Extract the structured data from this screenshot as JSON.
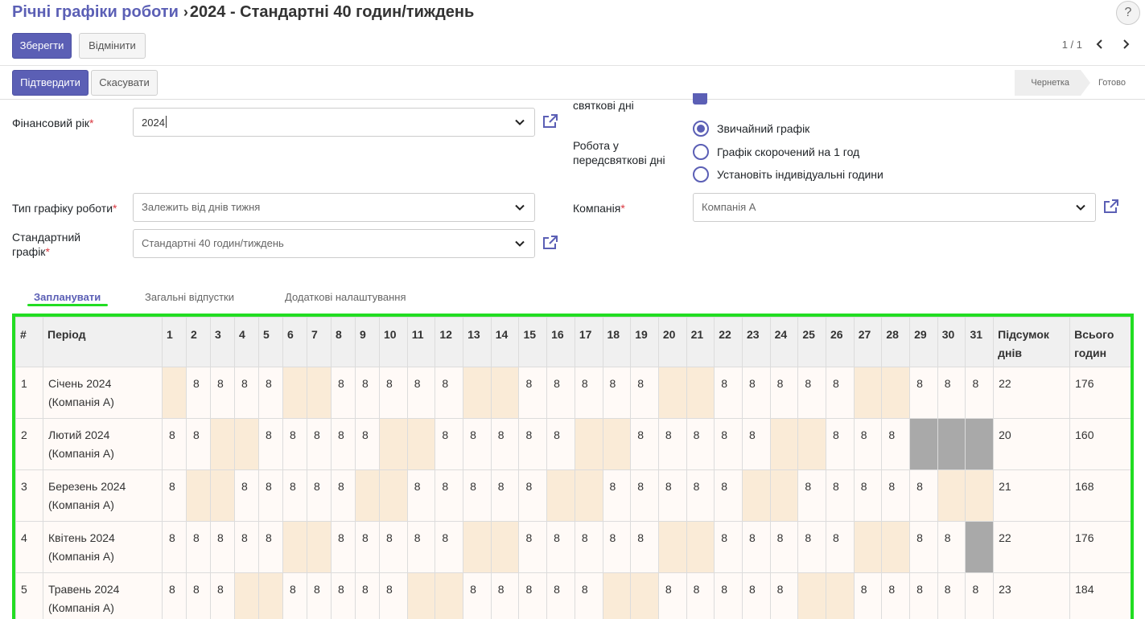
{
  "breadcrumb": {
    "parent": "Річні графіки роботи",
    "separator": "›",
    "current": "2024 - Стандартні 40 годин/тиждень"
  },
  "help_label": "?",
  "toolbar": {
    "save_label": "Зберегти",
    "discard_label": "Відмінити",
    "pager": "1 / 1"
  },
  "statusbar": {
    "confirm_label": "Підтвердити",
    "cancel_label": "Скасувати",
    "stages": [
      "Чернетка",
      "Готово"
    ]
  },
  "form": {
    "fiscal_year_label": "Фінансовий рік",
    "fiscal_year_value": "2024",
    "schedule_type_label": "Тип графіку роботи",
    "schedule_type_value": "Залежить від днів тижня",
    "standard_label_line1": "Стандартний",
    "standard_label_line2": "графік",
    "standard_value": "Стандартні 40 годин/тиждень",
    "holidays_label": "святкові дні",
    "preholiday_label_line1": "Робота у",
    "preholiday_label_line2": "передсвяткові дні",
    "preholiday_options": [
      "Звичайний графік",
      "Графік скорочений на 1 год",
      "Установіть індивідуальні години"
    ],
    "company_label": "Компанія",
    "company_value": "Компанія А",
    "required_mark": "*"
  },
  "tabs": [
    "Запланувати",
    "Загальні відпустки",
    "Додаткові налаштування"
  ],
  "table": {
    "col_index": "#",
    "col_period": "Період",
    "days": [
      "1",
      "2",
      "3",
      "4",
      "5",
      "6",
      "7",
      "8",
      "9",
      "10",
      "11",
      "12",
      "13",
      "14",
      "15",
      "16",
      "17",
      "18",
      "19",
      "20",
      "21",
      "22",
      "23",
      "24",
      "25",
      "26",
      "27",
      "28",
      "29",
      "30",
      "31"
    ],
    "col_total_days_line1": "Підсумок",
    "col_total_days_line2": "днів",
    "col_total_hours_line1": "Всього",
    "col_total_hours_line2": "годин",
    "rows": [
      {
        "index": "1",
        "period_line1": "Січень 2024",
        "period_line2": "(Компанія А)",
        "cells": [
          "w",
          "8",
          "8",
          "8",
          "8",
          "w",
          "w",
          "8",
          "8",
          "8",
          "8",
          "8",
          "w",
          "w",
          "8",
          "8",
          "8",
          "8",
          "8",
          "w",
          "w",
          "8",
          "8",
          "8",
          "8",
          "8",
          "w",
          "w",
          "8",
          "8",
          "8"
        ],
        "total_days": "22",
        "total_hours": "176"
      },
      {
        "index": "2",
        "period_line1": "Лютий 2024",
        "period_line2": "(Компанія А)",
        "cells": [
          "8",
          "8",
          "w",
          "w",
          "8",
          "8",
          "8",
          "8",
          "8",
          "w",
          "w",
          "8",
          "8",
          "8",
          "8",
          "8",
          "w",
          "w",
          "8",
          "8",
          "8",
          "8",
          "8",
          "w",
          "w",
          "8",
          "8",
          "8",
          "g",
          "g",
          "g"
        ],
        "total_days": "20",
        "total_hours": "160"
      },
      {
        "index": "3",
        "period_line1": "Березень 2024",
        "period_line2": "(Компанія А)",
        "cells": [
          "8",
          "w",
          "w",
          "8",
          "8",
          "8",
          "8",
          "8",
          "w",
          "w",
          "8",
          "8",
          "8",
          "8",
          "8",
          "w",
          "w",
          "8",
          "8",
          "8",
          "8",
          "8",
          "w",
          "w",
          "8",
          "8",
          "8",
          "8",
          "8",
          "w",
          "w"
        ],
        "total_days": "21",
        "total_hours": "168"
      },
      {
        "index": "4",
        "period_line1": "Квітень 2024",
        "period_line2": "(Компанія А)",
        "cells": [
          "8",
          "8",
          "8",
          "8",
          "8",
          "w",
          "w",
          "8",
          "8",
          "8",
          "8",
          "8",
          "w",
          "w",
          "8",
          "8",
          "8",
          "8",
          "8",
          "w",
          "w",
          "8",
          "8",
          "8",
          "8",
          "8",
          "w",
          "w",
          "8",
          "8",
          "g"
        ],
        "total_days": "22",
        "total_hours": "176"
      },
      {
        "index": "5",
        "period_line1": "Травень 2024",
        "period_line2": "(Компанія А)",
        "cells": [
          "8",
          "8",
          "8",
          "w",
          "w",
          "8",
          "8",
          "8",
          "8",
          "8",
          "w",
          "w",
          "8",
          "8",
          "8",
          "8",
          "8",
          "w",
          "w",
          "8",
          "8",
          "8",
          "8",
          "8",
          "w",
          "w",
          "8",
          "8",
          "8",
          "8",
          "8"
        ],
        "total_days": "23",
        "total_hours": "184"
      }
    ]
  },
  "colors": {
    "accent": "#5b5fb5",
    "weekend": "#faebd7",
    "invalid_day": "#a9a9a9",
    "highlight": "#22dd22"
  }
}
